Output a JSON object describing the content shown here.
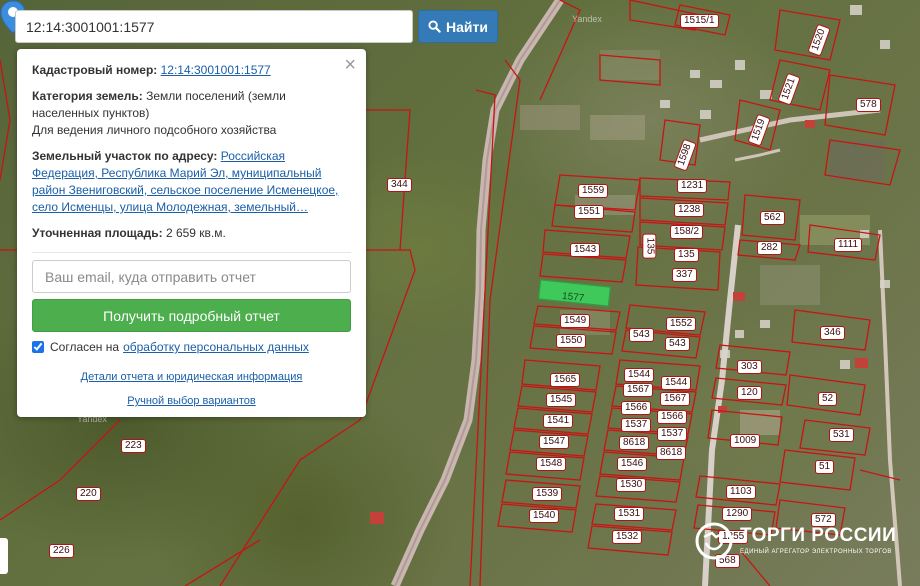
{
  "search": {
    "value": "12:14:3001001:1577",
    "button_label": "Найти"
  },
  "popup": {
    "close_symbol": "×",
    "cadastral_label": "Кадастровый номер:",
    "cadastral_value": "12:14:3001001:1577",
    "land_category_label": "Категория земель:",
    "land_category_value": "Земли поселений (земли населенных пунктов)",
    "land_use": "Для ведения личного подсобного хозяйства",
    "address_label": "Земельный участок по адресу:",
    "address_value": "Российская Федерация, Республика Марий Эл, муниципальный район Звениговский, сельское поселение Исменецкое, село Исменцы, улица Молодежная, земельный…",
    "area_label": "Уточненная площадь:",
    "area_value": "2 659 кв.м.",
    "email_placeholder": "Ваш email, куда отправить отчет",
    "report_button": "Получить подробный отчет",
    "consent_text": "Согласен на",
    "consent_link": "обработку персональных данных",
    "details_link": "Детали отчета и юридическая информация",
    "manual_link": "Ручной выбор вариантов"
  },
  "map": {
    "selected_plot": "1577",
    "watermarks": [
      "Yandex",
      "Yandex"
    ],
    "plots": [
      "1515/1",
      "1520",
      "1521",
      "578",
      "1519",
      "1598",
      "1231",
      "344",
      "1559",
      "1551",
      "1238",
      "158/2",
      "562",
      "135",
      "282",
      "1111",
      "1543",
      "135",
      "337",
      "1552",
      "346",
      "1549",
      "543",
      "1550",
      "543",
      "303",
      "1565",
      "1544",
      "1544",
      "1567",
      "120",
      "52",
      "1545",
      "1567",
      "1566",
      "1566",
      "1541",
      "1537",
      "1537",
      "531",
      "1547",
      "8618",
      "1009",
      "8618",
      "1548",
      "1546",
      "51",
      "223",
      "1530",
      "1103",
      "1539",
      "220",
      "1531",
      "1290",
      "572",
      "1540",
      "1532",
      "1255",
      "226",
      "568"
    ]
  },
  "logo": {
    "title": "ТОРГИ РОССИИ",
    "subtitle": "ЕДИНЫЙ АГРЕГАТОР ЭЛЕКТРОННЫХ ТОРГОВ"
  },
  "colors": {
    "boundary": "#c81414",
    "road": "#c9b6b0",
    "search_button": "#337ab7",
    "report_button": "#4cae4c",
    "selected_plot": "#3ec95a",
    "pin": "#3b8de0",
    "link": "#1a5fa8"
  }
}
